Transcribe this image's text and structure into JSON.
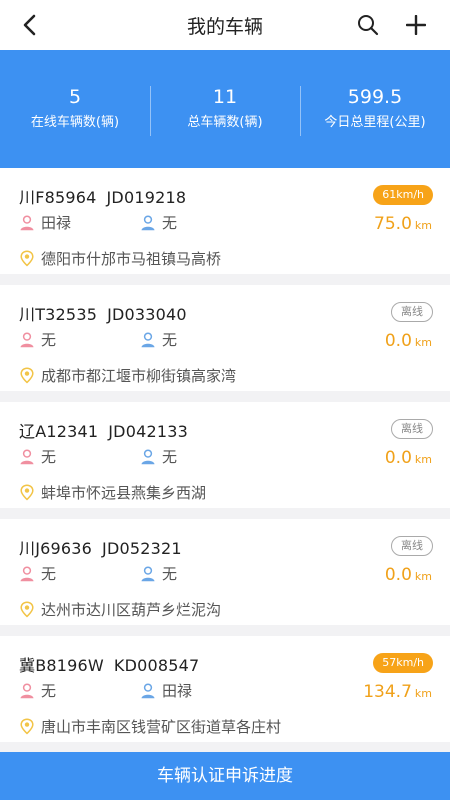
{
  "navbar": {
    "title": "我的车辆",
    "back_icon": "chevron-left-icon",
    "search_icon": "search-icon",
    "add_icon": "plus-icon"
  },
  "stats": [
    {
      "value": "5",
      "label": "在线车辆数(辆)"
    },
    {
      "value": "11",
      "label": "总车辆数(辆)"
    },
    {
      "value": "599.5",
      "label": "今日总里程(公里)"
    }
  ],
  "vehicles": [
    {
      "plate": "川F85964",
      "device": "JD019218",
      "status": "61km/h",
      "online": true,
      "owner": "田禄",
      "driver": "无",
      "mileage": "75.0",
      "unit": "km",
      "location": "德阳市什邡市马祖镇马高桥"
    },
    {
      "plate": "川T32535",
      "device": "JD033040",
      "status": "离线",
      "online": false,
      "owner": "无",
      "driver": "无",
      "mileage": "0.0",
      "unit": "km",
      "location": "成都市都江堰市柳街镇高家湾"
    },
    {
      "plate": "辽A12341",
      "device": "JD042133",
      "status": "离线",
      "online": false,
      "owner": "无",
      "driver": "无",
      "mileage": "0.0",
      "unit": "km",
      "location": "蚌埠市怀远县燕集乡西湖"
    },
    {
      "plate": "川J69636",
      "device": "JD052321",
      "status": "离线",
      "online": false,
      "owner": "无",
      "driver": "无",
      "mileage": "0.0",
      "unit": "km",
      "location": "达州市达川区葫芦乡烂泥沟"
    },
    {
      "plate": "冀B8196W",
      "device": "KD008547",
      "status": "57km/h",
      "online": true,
      "owner": "无",
      "driver": "田禄",
      "mileage": "134.7",
      "unit": "km",
      "location": "唐山市丰南区钱营矿区街道草各庄村"
    }
  ],
  "bottom_button": "车辆认证申诉进度",
  "colors": {
    "primary": "#3d91f2",
    "speed_badge": "#f7a318",
    "mileage": "#f0a11a",
    "owner_icon": "#f08fa0",
    "driver_icon": "#6aa6e6",
    "location_icon": "#f2c447"
  }
}
